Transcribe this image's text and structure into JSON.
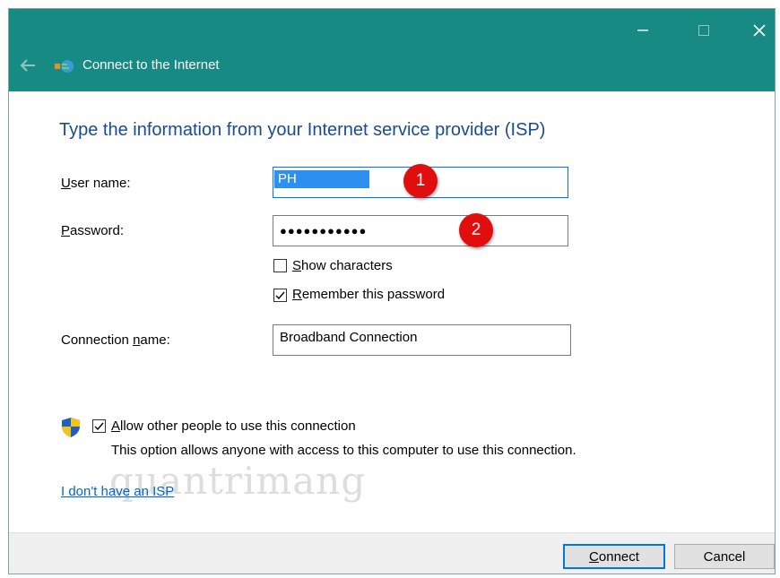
{
  "window": {
    "title": "Connect to the Internet",
    "accent_color": "#168a83",
    "controls": [
      "minimize-icon",
      "maximize-icon",
      "close-icon"
    ]
  },
  "heading": "Type the information from your Internet service provider (ISP)",
  "fields": {
    "username": {
      "label_first": "U",
      "label_rest": "ser name:",
      "value": "PH"
    },
    "password": {
      "label_first": "P",
      "label_rest": "assword:",
      "value": "●●●●●●●●●●●"
    },
    "connection_name": {
      "label_pre": "Connection ",
      "label_key": "n",
      "label_post": "ame:",
      "value": "Broadband Connection"
    }
  },
  "checkboxes": {
    "show_characters": {
      "key": "S",
      "rest": "how characters",
      "checked": false
    },
    "remember_password": {
      "key": "R",
      "rest": "emember this password",
      "checked": true
    },
    "allow_others": {
      "key": "A",
      "rest": "llow other people to use this connection",
      "checked": true
    }
  },
  "allow_description": "This option allows anyone with access to this computer to use this connection.",
  "link_text": "I don't have an ISP",
  "badges": [
    "1",
    "2"
  ],
  "buttons": {
    "connect": {
      "key": "C",
      "rest": "onnect"
    },
    "cancel": "Cancel"
  },
  "watermark": "quantrimang"
}
